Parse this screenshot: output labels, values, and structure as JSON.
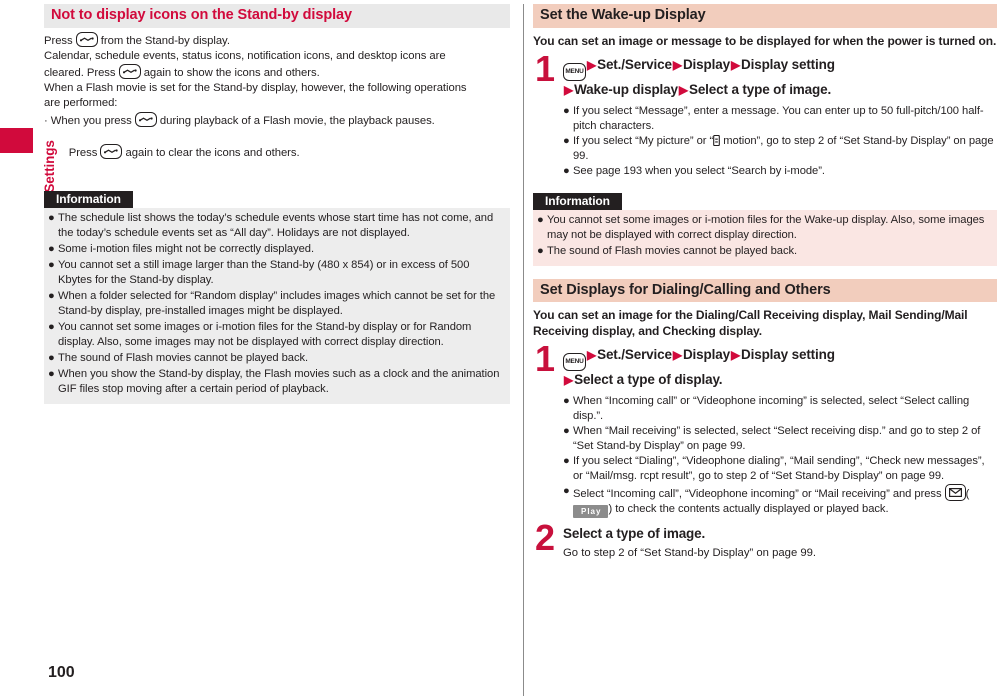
{
  "sidebar": {
    "chapter_label": "Sound/Screen/Light Settings",
    "marker_color": "#d10a3c"
  },
  "page_number": "100",
  "left_column": {
    "heading": "Not to display icons on the Stand-by display",
    "paragraphs": [
      {
        "before": "Press ",
        "key": "clear-key",
        "after": " from the Stand-by display."
      },
      {
        "text": "Calendar, schedule events, status icons, notification icons, and desktop icons are"
      },
      {
        "before": "cleared. Press ",
        "key": "clear-key",
        "after": " again to show the icons and others."
      },
      {
        "text": "When a Flash movie is set for the Stand-by display, however, the following operations"
      },
      {
        "text": "are performed:"
      },
      {
        "before": "· When you press ",
        "key": "clear-key",
        "after": " during playback of a Flash movie, the playback pauses."
      },
      {
        "before": "  Press ",
        "key": "clear-key",
        "after": " again to clear the icons and others."
      }
    ],
    "information": {
      "label": "Information",
      "items": [
        "The schedule list shows the today’s schedule events whose start time has not come, and the today’s schedule events set as “All day”. Holidays are not displayed.",
        "Some i-motion files might not be correctly displayed.",
        "You cannot set a still image larger than the Stand-by (480 x 854) or in excess of 500 Kbytes for the Stand-by display.",
        "When a folder selected for “Random display” includes images which cannot be set for the Stand-by display, pre-installed images might be displayed.",
        "You cannot set some images or i-motion files for the Stand-by display or for Random display. Also, some images may not be displayed with correct display direction.",
        "The sound of Flash movies cannot be played back.",
        "When you show the Stand-by display, the Flash movies such as a clock and the animation GIF files stop moving after a certain period of playback."
      ]
    }
  },
  "right_column": {
    "section1": {
      "heading": "Set the Wake-up Display",
      "lead": "You can set an image or message to be displayed for when the power is turned on.",
      "step_number": "1",
      "step_parts": {
        "menu_key": "MENU",
        "part1": "Set./Service",
        "part2": "Display",
        "part3": "Display setting",
        "part4": "Wake-up display",
        "part5": "Select a type of image."
      },
      "bullets": [
        "If you select “Message”, enter a message. You can enter up to 50 full-pitch/100 half-pitch characters.",
        "If you select “My picture” or “ \u0000 motion”, go to step 2 of “Set Stand-by Display” on page 99.",
        "See page 193 when you select “Search by i-mode”."
      ],
      "bullet2_before": "If you select “My picture” or “",
      "bullet2_after": " motion”, go to step 2 of “Set Stand-by Display” on page 99.",
      "information": {
        "label": "Information",
        "items": [
          "You cannot set some images or i-motion files for the Wake-up display. Also, some images may not be displayed with correct display direction.",
          "The sound of Flash movies cannot be played back."
        ]
      }
    },
    "section2": {
      "heading": "Set Displays for Dialing/Calling and Others",
      "lead": "You can set an image for the Dialing/Call Receiving display, Mail Sending/Mail Receiving display, and Checking display.",
      "step1_number": "1",
      "step1_parts": {
        "menu_key": "MENU",
        "part1": "Set./Service",
        "part2": "Display",
        "part3": "Display setting",
        "part4": "Select a type of display."
      },
      "bullets": [
        "When “Incoming call” or “Videophone incoming” is selected, select “Select calling disp.”.",
        "When “Mail receiving” is selected, select “Select receiving disp.” and go to step 2 of “Set Stand-by Display” on page 99.",
        "If you select “Dialing”, “Videophone dialing”, “Mail sending”, “Check new messages”, or “Mail/msg. rcpt result”, go to step 2 of “Set Stand-by Display” on page 99."
      ],
      "bullet4_before": "Select “Incoming call”, “Videophone incoming” or “Mail receiving” and press ",
      "bullet4_play": "Play",
      "bullet4_after": ") to check the contents actually displayed or played back.",
      "step2_number": "2",
      "step2_title": "Select a type of image.",
      "step2_sub": "Go to step 2 of “Set Stand-by Display” on page 99."
    }
  },
  "icons": {
    "clear_key": "clear-key-icon",
    "menu_key": "menu-key-icon",
    "mail_key": "mail-key-icon",
    "imode_mark": "i-mode-mark-icon",
    "bullet": "●"
  }
}
